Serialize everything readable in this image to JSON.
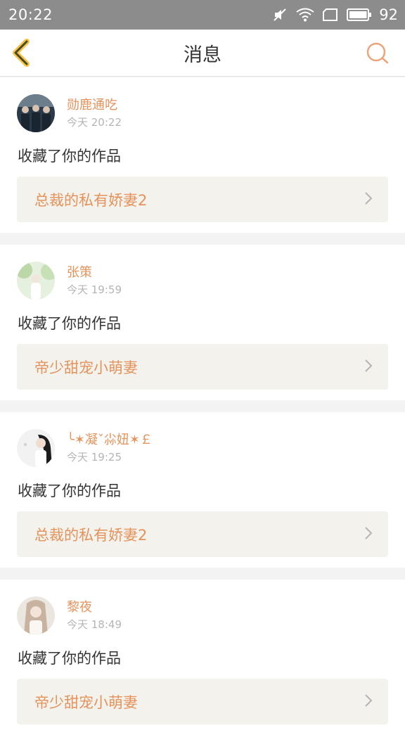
{
  "status_bar": {
    "time": "20:22",
    "battery": "92",
    "icons": [
      "mute-icon",
      "wifi-icon",
      "sim-icon",
      "battery-icon"
    ]
  },
  "header": {
    "title": "消息",
    "back_icon": "chevron-left-icon",
    "search_icon": "search-icon"
  },
  "colors": {
    "accent": "#e4935c",
    "status_bar": "#8c8c8c",
    "card_work_bg": "#f3f2ec"
  },
  "messages": [
    {
      "user": "勋鹿通吃",
      "time": "今天 20:22",
      "action": "收藏了你的作品",
      "work_title": "总裁的私有娇妻2"
    },
    {
      "user": "张策",
      "time": "今天 19:59",
      "action": "收藏了你的作品",
      "work_title": "帝少甜宠小萌妻"
    },
    {
      "user": "╰✶凝ˇ尛妞✶￡",
      "time": "今天 19:25",
      "action": "收藏了你的作品",
      "work_title": "总裁的私有娇妻2"
    },
    {
      "user": "黎夜",
      "time": "今天 18:49",
      "action": "收藏了你的作品",
      "work_title": "帝少甜宠小萌妻"
    }
  ]
}
